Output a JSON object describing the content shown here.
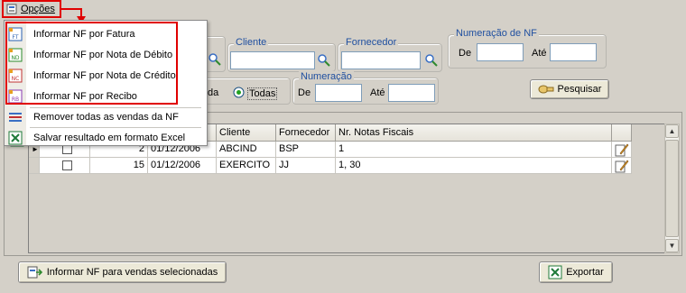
{
  "menu": {
    "opcoes_label": "Opções"
  },
  "filters": {
    "cliente": {
      "title": "Cliente",
      "value": ""
    },
    "fornecedor": {
      "title": "Fornecedor",
      "value": ""
    },
    "numeracao_nf": {
      "title": "Numeração de NF",
      "de_label": "De",
      "ate_label": "Até",
      "de_value": "",
      "ate_value": ""
    },
    "numeracao": {
      "title": "Numeração",
      "de_label": "De",
      "ate_label": "Até",
      "de_value": "",
      "ate_value": ""
    },
    "radio_partial_label": "da",
    "radio_todas_label": "Todas",
    "radio_todas_checked": true
  },
  "buttons": {
    "pesquisar": "Pesquisar",
    "informar_nf_vendas": "Informar NF para vendas selecionadas",
    "exportar": "Exportar"
  },
  "grid": {
    "columns": [
      "",
      "",
      "",
      "",
      "Cliente",
      "Fornecedor",
      "Nr. Notas Fiscais",
      ""
    ],
    "rows": [
      {
        "num": "2",
        "date": "01/12/2006",
        "cliente": "ABCIND",
        "fornecedor": "BSP",
        "notas": "1",
        "current": true
      },
      {
        "num": "15",
        "date": "01/12/2006",
        "cliente": "EXERCITO",
        "fornecedor": "JJ",
        "notas": "1, 30",
        "current": false
      }
    ]
  },
  "dropdown": {
    "items": [
      {
        "icon": "ft-icon",
        "badge": "FT",
        "label": "Informar NF por Fatura"
      },
      {
        "icon": "nd-icon",
        "badge": "ND",
        "label": "Informar NF por Nota de Débito"
      },
      {
        "icon": "nc-icon",
        "badge": "NC",
        "label": "Informar NF por Nota de Crédito"
      },
      {
        "icon": "rb-icon",
        "badge": "RB",
        "label": "Informar NF por Recibo"
      },
      {
        "icon": "remove-list-icon",
        "badge": "",
        "label": "Remover todas as vendas da NF"
      },
      {
        "icon": "excel-icon",
        "badge": "",
        "label": "Salvar resultado em formato Excel"
      }
    ]
  },
  "colors": {
    "highlight": "#e00000",
    "group_title": "#1f4fa0",
    "window_bg": "#d4d0c8"
  }
}
